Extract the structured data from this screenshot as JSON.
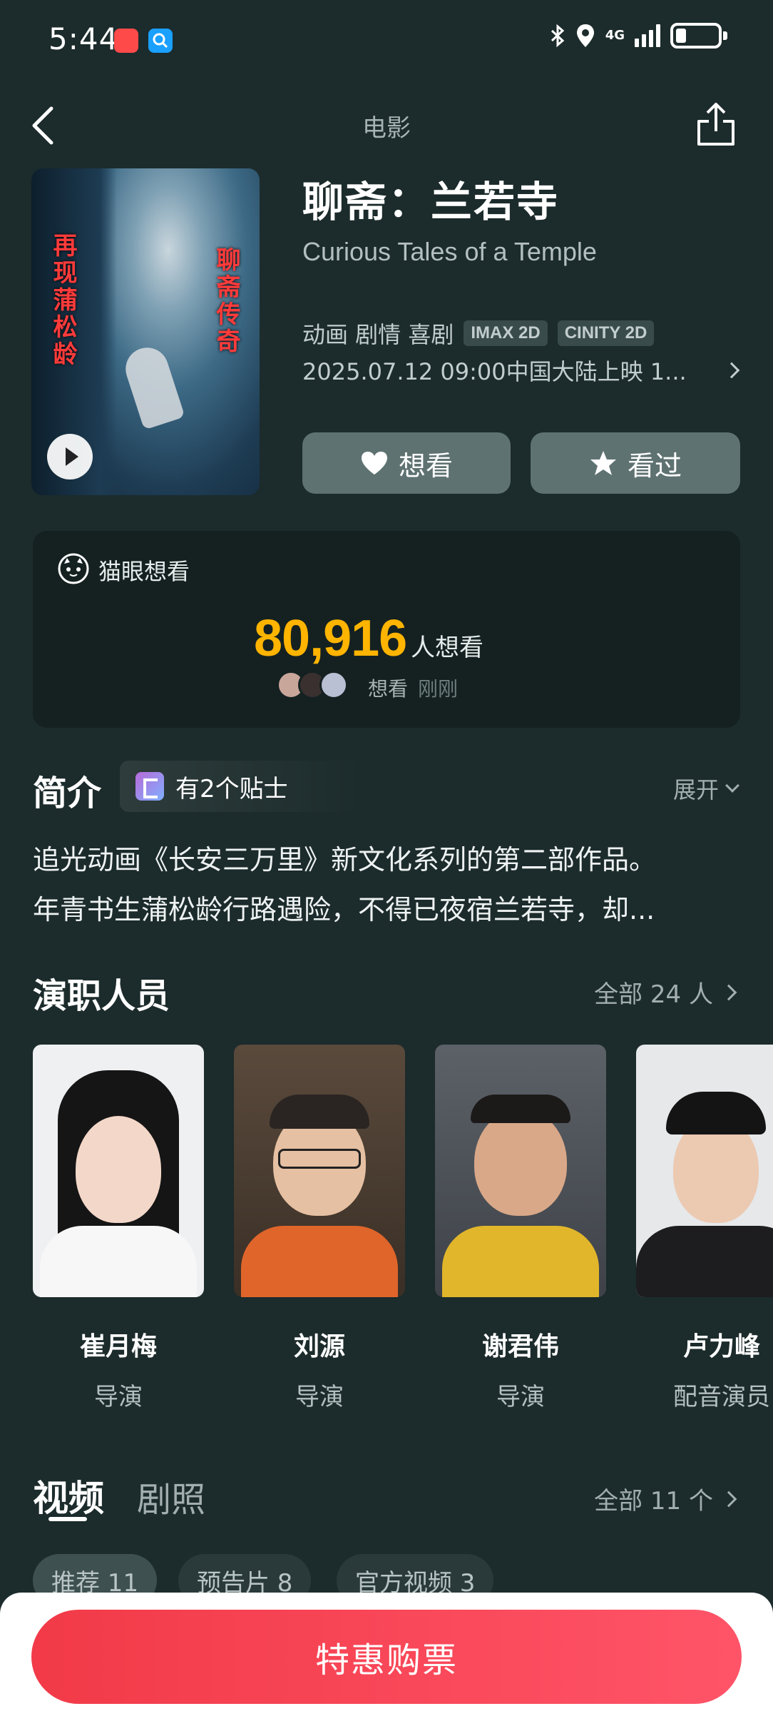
{
  "status_bar": {
    "time": "5:44",
    "network": "4G",
    "icons": [
      "huawei-app-icon",
      "search-app-icon",
      "bluetooth-icon",
      "location-icon",
      "signal-icon",
      "battery-icon"
    ]
  },
  "header": {
    "title": "电影"
  },
  "poster": {
    "slogan_left": "再现蒲松龄",
    "slogan_right": "聊斋传奇"
  },
  "movie": {
    "title": "聊斋：兰若寺",
    "english_title": "Curious Tales of a Temple",
    "genres": "动画 剧情 喜剧",
    "tags": [
      "IMAX 2D",
      "CINITY 2D"
    ],
    "release": "2025.07.12 09:00中国大陆上映 1..."
  },
  "actions": {
    "want_label": "想看",
    "seen_label": "看过"
  },
  "want_card": {
    "label": "猫眼想看",
    "count": "80,916",
    "unit": "人想看",
    "recent_action": "想看",
    "recent_time": "刚刚"
  },
  "intro": {
    "title": "简介",
    "tips": "有2个贴士",
    "expand": "展开",
    "line1": "追光动画《长安三万里》新文化系列的第二部作品。",
    "line2": "年青书生蒲松龄行路遇险，不得已夜宿兰若寺，却..."
  },
  "cast": {
    "title": "演职人员",
    "all": "全部 24 人",
    "members": [
      {
        "name": "崔月梅",
        "role": "导演"
      },
      {
        "name": "刘源",
        "role": "导演"
      },
      {
        "name": "谢君伟",
        "role": "导演"
      },
      {
        "name": "卢力峰",
        "role": "配音演员"
      }
    ]
  },
  "media": {
    "tab_video": "视频",
    "tab_stills": "剧照",
    "all": "全部 11 个",
    "chips": [
      "推荐 11",
      "预告片 8",
      "官方视频 3"
    ]
  },
  "bottom": {
    "buy_label": "特惠购票"
  },
  "colors": {
    "background": "#1c2b2b",
    "accent_count": "#ffb400",
    "buy_button": "#f23a48"
  }
}
